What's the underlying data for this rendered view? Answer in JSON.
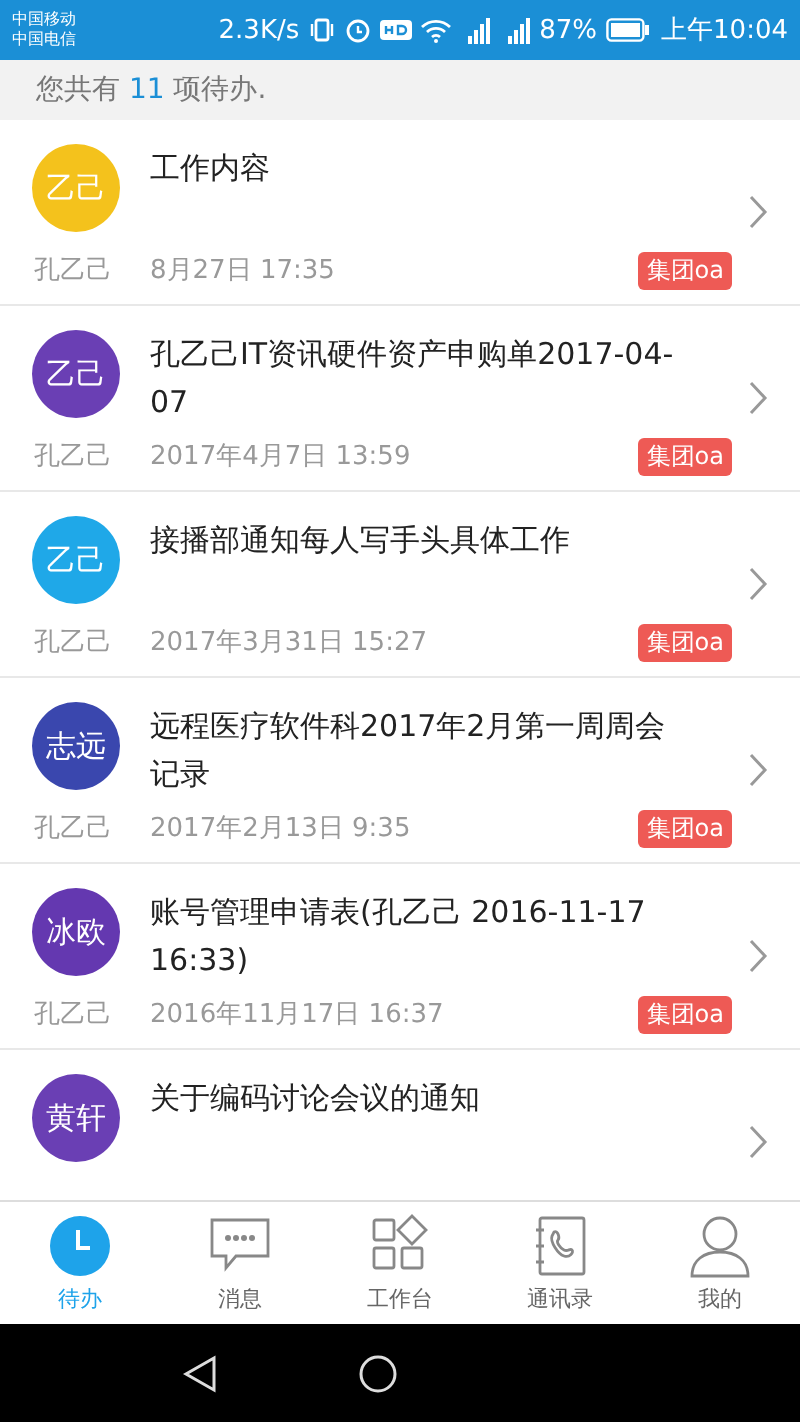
{
  "status_bar": {
    "carriers": [
      "中国移动",
      "中国电信"
    ],
    "speed": "2.3K/s",
    "battery_text": "87%",
    "time": "上午10:04"
  },
  "summary": {
    "before": "您共有",
    "count": "11",
    "after": "项待办."
  },
  "items": [
    {
      "avatar": "乙己",
      "color": "#f4c21c",
      "title": "工作内容",
      "name": "孔乙己",
      "date": "8月27日 17:35",
      "tag": "集团oa"
    },
    {
      "avatar": "乙己",
      "color": "#6a3fb4",
      "title": "孔乙己IT资讯硬件资产申购单2017-04-07",
      "name": "孔乙己",
      "date": "2017年4月7日 13:59",
      "tag": "集团oa"
    },
    {
      "avatar": "乙己",
      "color": "#1fa8e8",
      "title": "接播部通知每人写手头具体工作",
      "name": "孔乙己",
      "date": "2017年3月31日 15:27",
      "tag": "集团oa"
    },
    {
      "avatar": "志远",
      "color": "#3a47ae",
      "title": "远程医疗软件科2017年2月第一周周会记录",
      "name": "孔乙己",
      "date": "2017年2月13日 9:35",
      "tag": "集团oa"
    },
    {
      "avatar": "冰欧",
      "color": "#6438b0",
      "title": "账号管理申请表(孔乙己 2016-11-17 16:33)",
      "name": "孔乙己",
      "date": "2016年11月17日 16:37",
      "tag": "集团oa"
    },
    {
      "avatar": "黄轩",
      "color": "#6a3fb4",
      "title": "关于编码讨论会议的通知"
    }
  ],
  "tabs": [
    {
      "label": "待办",
      "kind": "clock",
      "selected": true
    },
    {
      "label": "消息",
      "kind": "chat",
      "selected": false
    },
    {
      "label": "工作台",
      "kind": "grid",
      "selected": false
    },
    {
      "label": "通讯录",
      "kind": "book",
      "selected": false
    },
    {
      "label": "我的",
      "kind": "person",
      "selected": false
    }
  ]
}
